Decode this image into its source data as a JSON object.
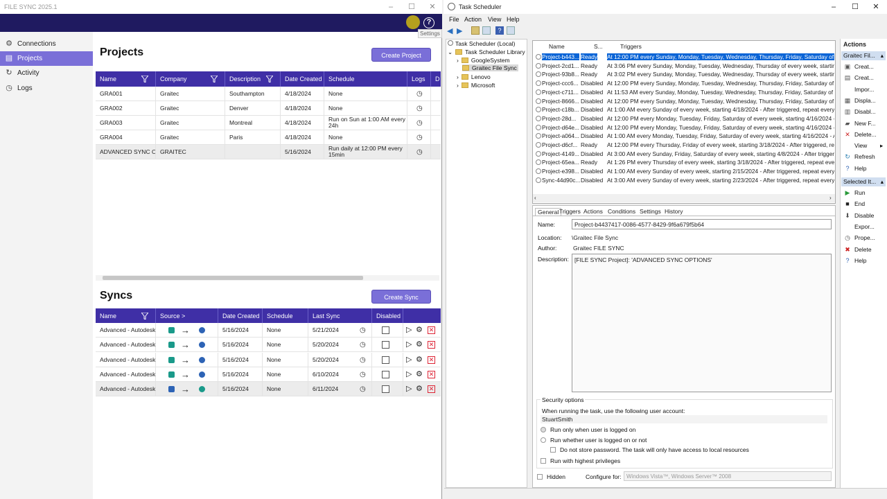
{
  "fs": {
    "title": "FILE SYNC 2025.1",
    "tooltip": "Settings",
    "help": "?",
    "nav": [
      {
        "label": "Connections",
        "icon": "connections-icon",
        "active": false
      },
      {
        "label": "Projects",
        "icon": "projects-icon",
        "active": true
      },
      {
        "label": "Activity",
        "icon": "activity-icon",
        "active": false
      },
      {
        "label": "Logs",
        "icon": "logs-icon",
        "active": false
      }
    ],
    "projects": {
      "heading": "Projects",
      "create_label": "Create Project",
      "headers": [
        "Name",
        "Company",
        "Description",
        "Date Created",
        "Schedule",
        "Logs",
        "D"
      ],
      "rows": [
        {
          "name": "GRA001",
          "company": "Graitec",
          "description": "Southampton",
          "date": "4/18/2024",
          "schedule": "None"
        },
        {
          "name": "GRA002",
          "company": "Graitec",
          "description": "Denver",
          "date": "4/18/2024",
          "schedule": "None"
        },
        {
          "name": "GRA003",
          "company": "Graitec",
          "description": "Montreal",
          "date": "4/18/2024",
          "schedule": "Run on Sun at 1:00 AM every 24h"
        },
        {
          "name": "GRA004",
          "company": "Graitec",
          "description": "Paris",
          "date": "4/18/2024",
          "schedule": "None"
        },
        {
          "name": "ADVANCED SYNC OPTIONS",
          "company": "GRAITEC",
          "description": "",
          "date": "5/16/2024",
          "schedule": "Run daily at 12:00 PM every 15min"
        }
      ]
    },
    "syncs": {
      "heading": "Syncs",
      "create_label": "Create Sync",
      "headers": [
        "Name",
        "Source > Destination",
        "Date Created",
        "Schedule",
        "Last Sync",
        "Disabled"
      ],
      "rows": [
        {
          "name": "Advanced - Autodesk",
          "date": "5/16/2024",
          "schedule": "None",
          "last": "5/21/2024"
        },
        {
          "name": "Advanced - Autodesk",
          "date": "5/16/2024",
          "schedule": "None",
          "last": "5/20/2024"
        },
        {
          "name": "Advanced - Autodesk",
          "date": "5/16/2024",
          "schedule": "None",
          "last": "5/20/2024"
        },
        {
          "name": "Advanced - Autodesk",
          "date": "5/16/2024",
          "schedule": "None",
          "last": "6/10/2024"
        },
        {
          "name": "Advanced - Autodesk",
          "date": "5/16/2024",
          "schedule": "None",
          "last": "6/11/2024"
        }
      ]
    }
  },
  "ts": {
    "title": "Task Scheduler",
    "menu": [
      "File",
      "Action",
      "View",
      "Help"
    ],
    "tree": {
      "root": "Task Scheduler (Local)",
      "library": "Task Scheduler Library",
      "children": [
        "GoogleSystem",
        "Graitec File Sync",
        "Lenovo",
        "Microsoft"
      ]
    },
    "list_headers": [
      "Name",
      "S...",
      "Triggers"
    ],
    "tasks": [
      {
        "name": "Project-b443...",
        "status": "Ready",
        "trigger": "At 12:00 PM every Sunday, Monday, Tuesday, Wednesday, Thursday, Friday, Saturday of every"
      },
      {
        "name": "Project-2cd1...",
        "status": "Ready",
        "trigger": "At 3:06 PM every Sunday, Monday, Tuesday, Wednesday, Thursday of every week, starting 6/6/2024 - A"
      },
      {
        "name": "Project-93b8...",
        "status": "Ready",
        "trigger": "At 3:02 PM every Sunday, Monday, Tuesday, Wednesday, Thursday of every week, starting 6/6/2024 - A"
      },
      {
        "name": "Project-ccc6...",
        "status": "Disabled",
        "trigger": "At 12:00 PM every Sunday, Monday, Tuesday, Wednesday, Thursday, Friday, Saturday of every"
      },
      {
        "name": "Project-c711...",
        "status": "Disabled",
        "trigger": "At 11:53 AM every Sunday, Monday, Tuesday, Wednesday, Thursday, Friday, Saturday of every"
      },
      {
        "name": "Project-8666...",
        "status": "Disabled",
        "trigger": "At 12:00 PM every Sunday, Monday, Tuesday, Wednesday, Thursday, Friday, Saturday of every"
      },
      {
        "name": "Project-c18b...",
        "status": "Disabled",
        "trigger": "At 1:00 AM every Sunday of every week, starting 4/18/2024 - After triggered, repeat every 1.00:0"
      },
      {
        "name": "Project-28d...",
        "status": "Disabled",
        "trigger": "At 12:00 PM every Monday, Tuesday, Friday, Saturday of every week, starting 4/16/2024 - After"
      },
      {
        "name": "Project-d64e...",
        "status": "Disabled",
        "trigger": "At 12:00 PM every Monday, Tuesday, Friday, Saturday of every week, starting 4/16/2024 - After"
      },
      {
        "name": "Project-a064...",
        "status": "Disabled",
        "trigger": "At 1:00 AM every Monday, Tuesday, Friday, Saturday of every week, starting 4/16/2024 - After t"
      },
      {
        "name": "Project-d6cf...",
        "status": "Ready",
        "trigger": "At 12:00 PM every Thursday, Friday of every week, starting 3/18/2024 - After triggered, repeat e"
      },
      {
        "name": "Project-4149...",
        "status": "Disabled",
        "trigger": "At 3:00 AM every Sunday, Friday, Saturday of every week, starting 4/8/2024 - After triggered, re"
      },
      {
        "name": "Project-65ea...",
        "status": "Ready",
        "trigger": "At 1:26 PM every Thursday of every week, starting 3/18/2024 - After triggered, repeat every 1.00:"
      },
      {
        "name": "Project-e398...",
        "status": "Disabled",
        "trigger": "At 1:00 AM every Sunday of every week, starting 2/15/2024 - After triggered, repeat every 1.00:0"
      },
      {
        "name": "Sync-44d90c...",
        "status": "Disabled",
        "trigger": "At 3:00 AM every Sunday of every week, starting 2/23/2024 - After triggered, repeat every 06:00"
      }
    ],
    "tabs": [
      "General",
      "Triggers",
      "Actions",
      "Conditions",
      "Settings",
      "History"
    ],
    "detail": {
      "name_label": "Name:",
      "name": "Project-b4437417-0086-4577-8429-9f6a679f5b64",
      "location_label": "Location:",
      "location": "\\Graitec File Sync",
      "author_label": "Author:",
      "author": "Graitec FILE SYNC",
      "description_label": "Description:",
      "description": "[FILE SYNC Project]: 'ADVANCED SYNC OPTIONS'",
      "security_title": "Security options",
      "security_text": "When running the task, use the following user account:",
      "user": "StuartSmith",
      "opt1": "Run only when user is logged on",
      "opt2": "Run whether user is logged on or not",
      "opt3": "Do not store password.  The task will only have access to local resources",
      "opt4": "Run with highest privileges",
      "hidden": "Hidden",
      "configure_label": "Configure for:",
      "configure_value": "Windows Vista™, Windows Server™ 2008"
    },
    "actions": {
      "title": "Actions",
      "group1": "Graitec Fil...",
      "items1": [
        {
          "label": "Creat...",
          "icon": "create-basic-task-icon"
        },
        {
          "label": "Creat...",
          "icon": "create-task-icon"
        },
        {
          "label": "Impor...",
          "icon": "import-icon"
        },
        {
          "label": "Displa...",
          "icon": "display-icon"
        },
        {
          "label": "Disabl...",
          "icon": "disable-history-icon"
        },
        {
          "label": "New F...",
          "icon": "new-folder-icon"
        },
        {
          "label": "Delete...",
          "icon": "delete-folder-icon"
        },
        {
          "label": "View",
          "icon": "view-icon"
        },
        {
          "label": "Refresh",
          "icon": "refresh-icon"
        },
        {
          "label": "Help",
          "icon": "help-icon"
        }
      ],
      "group2": "Selected It...",
      "items2": [
        {
          "label": "Run",
          "icon": "run-icon"
        },
        {
          "label": "End",
          "icon": "end-icon"
        },
        {
          "label": "Disable",
          "icon": "disable-icon"
        },
        {
          "label": "Expor...",
          "icon": "export-icon"
        },
        {
          "label": "Prope...",
          "icon": "properties-icon"
        },
        {
          "label": "Delete",
          "icon": "delete-icon"
        },
        {
          "label": "Help",
          "icon": "help-icon"
        }
      ]
    }
  },
  "colors": {
    "band": "#1f1a60",
    "accent": "#7a6fd8",
    "header": "#3f2fa6",
    "selection": "#0a64d6"
  }
}
